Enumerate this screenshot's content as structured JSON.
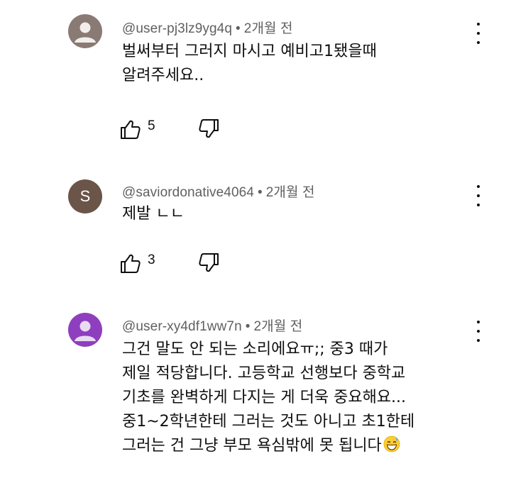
{
  "comments": [
    {
      "handle": "@user-pj3lz9yg4q",
      "separator": "•",
      "time": "2개월 전",
      "text": "벌써부터 그러지 마시고 예비고1됐을때\n알려주세요..",
      "likes": "5",
      "avatar": {
        "type": "default-silhouette",
        "bg": "#8a7a74",
        "fg": "#f2eeec"
      }
    },
    {
      "handle": "@saviordonative4064",
      "separator": "•",
      "time": "2개월 전",
      "text": "제발 ㄴㄴ",
      "likes": "3",
      "avatar": {
        "type": "letter",
        "letter": "S",
        "bg": "#6b5448"
      }
    },
    {
      "handle": "@user-xy4df1ww7n",
      "separator": "•",
      "time": "2개월 전",
      "text": "그건 말도 안 되는 소리에요ㅠ;; 중3 때가\n제일 적당합니다. 고등학교 선행보다 중학교\n기초를 완벽하게 다지는 게 더욱 중요해요...\n중1~2학년한테 그러는 것도 아니고 초1한테\n그러는 건 그냥 부모 욕심밖에 못 됩니다",
      "emoji": "grinning-face-with-sweat",
      "avatar": {
        "type": "default-silhouette",
        "bg": "#8e3fbf",
        "fg": "#e9dcf2"
      }
    }
  ],
  "icons": {
    "more": "more-vertical-icon",
    "like": "thumbs-up-icon",
    "dislike": "thumbs-down-icon"
  }
}
